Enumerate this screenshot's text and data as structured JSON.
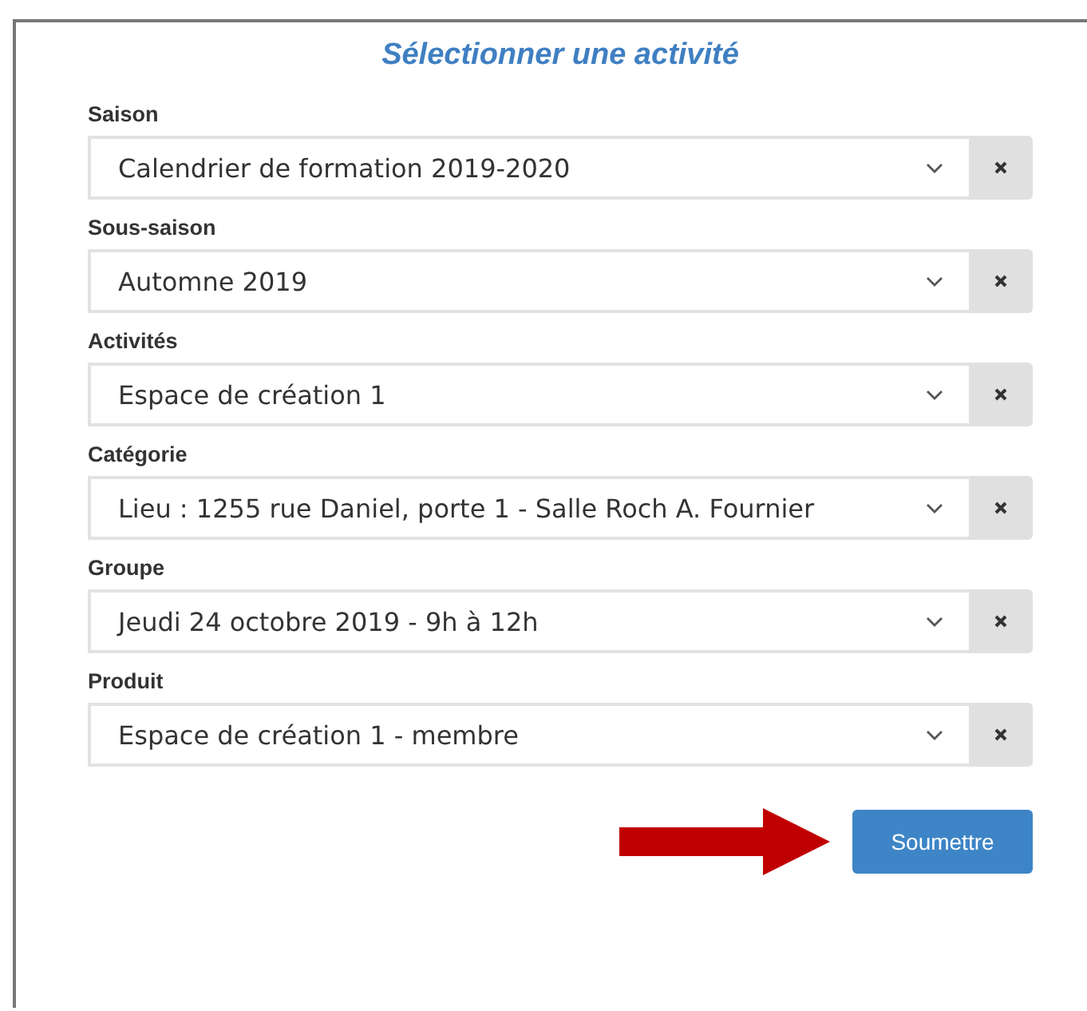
{
  "title": "Sélectionner une activité",
  "fields": [
    {
      "label": "Saison",
      "value": "Calendrier de formation 2019-2020"
    },
    {
      "label": "Sous-saison",
      "value": "Automne 2019"
    },
    {
      "label": "Activités",
      "value": "Espace de création 1"
    },
    {
      "label": "Catégorie",
      "value": "Lieu : 1255 rue Daniel, porte 1 - Salle Roch A. Fournier"
    },
    {
      "label": "Groupe",
      "value": "Jeudi 24 octobre 2019 - 9h à 12h"
    },
    {
      "label": "Produit",
      "value": "Espace de création 1 - membre"
    }
  ],
  "submit": "Soumettre"
}
